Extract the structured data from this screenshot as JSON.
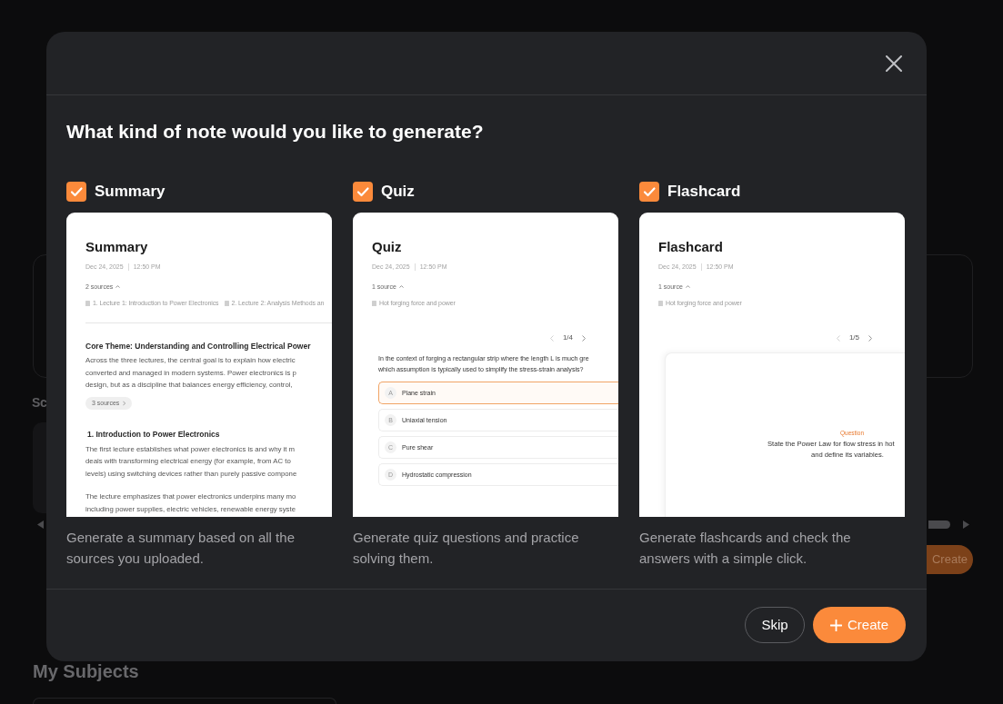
{
  "background": {
    "section_heading": "Sc",
    "create_button": "Create",
    "subjects_heading": "My Subjects"
  },
  "dialog": {
    "title": "What kind of note would you like to generate?",
    "options": [
      {
        "label": "Summary",
        "checked": true,
        "description": "Generate a summary based on all the sources you uploaded.",
        "preview": {
          "kind": "summary",
          "title": "Summary",
          "date": "Dec 24, 2025",
          "time": "12:50 PM",
          "sources_toggle": "2 sources",
          "sources": [
            "1. Lecture 1: Introduction to Power Electronics",
            "2. Lecture 2: Analysis Methods an"
          ],
          "sections": [
            {
              "heading": "Core Theme: Understanding and Controlling Electrical Power",
              "paragraphs": [
                [
                  "Across the three lectures, the central goal is to explain how electric",
                  "converted and managed in modern systems. Power electronics is p",
                  "design, but as a discipline that balances energy efficiency, control,"
                ]
              ],
              "chip": "3 sources"
            },
            {
              "heading": "1. Introduction to Power Electronics",
              "paragraphs": [
                [
                  "The first lecture establishes what power electronics is and why it m",
                  "deals with transforming electrical energy (for example, from AC to",
                  "levels) using switching devices rather than purely passive compone"
                ],
                [
                  "The lecture emphasizes that power electronics underpins many mo",
                  "including power supplies, electric vehicles, renewable energy syste"
                ]
              ]
            }
          ]
        }
      },
      {
        "label": "Quiz",
        "checked": true,
        "description": "Generate quiz questions and practice solving them.",
        "preview": {
          "kind": "quiz",
          "title": "Quiz",
          "date": "Dec 24, 2025",
          "time": "12:50 PM",
          "sources_toggle": "1 source",
          "sources": [
            "Hot forging force and power"
          ],
          "pager": "1/4",
          "question": [
            "In the context of forging a rectangular strip where the length L is much gre",
            "which assumption is typically used to simplify the stress-strain analysis?"
          ],
          "answers": [
            {
              "letter": "A",
              "text": "Plane strain",
              "selected": true
            },
            {
              "letter": "B",
              "text": "Uniaxial tension",
              "selected": false
            },
            {
              "letter": "C",
              "text": "Pure shear",
              "selected": false
            },
            {
              "letter": "D",
              "text": "Hydrostatic compression",
              "selected": false
            }
          ]
        }
      },
      {
        "label": "Flashcard",
        "checked": true,
        "description": "Generate flashcards and check the answers with a simple click.",
        "preview": {
          "kind": "flashcard",
          "title": "Flashcard",
          "date": "Dec 24, 2025",
          "time": "12:50 PM",
          "sources_toggle": "1 source",
          "sources": [
            "Hot forging force and power"
          ],
          "pager": "1/5",
          "card_label": "Question",
          "card_text": [
            "State the Power Law for flow stress in hot",
            "and define its variables."
          ]
        }
      }
    ],
    "buttons": [
      {
        "label": "Skip",
        "kind": "secondary"
      },
      {
        "label": "Create",
        "kind": "primary"
      }
    ]
  }
}
